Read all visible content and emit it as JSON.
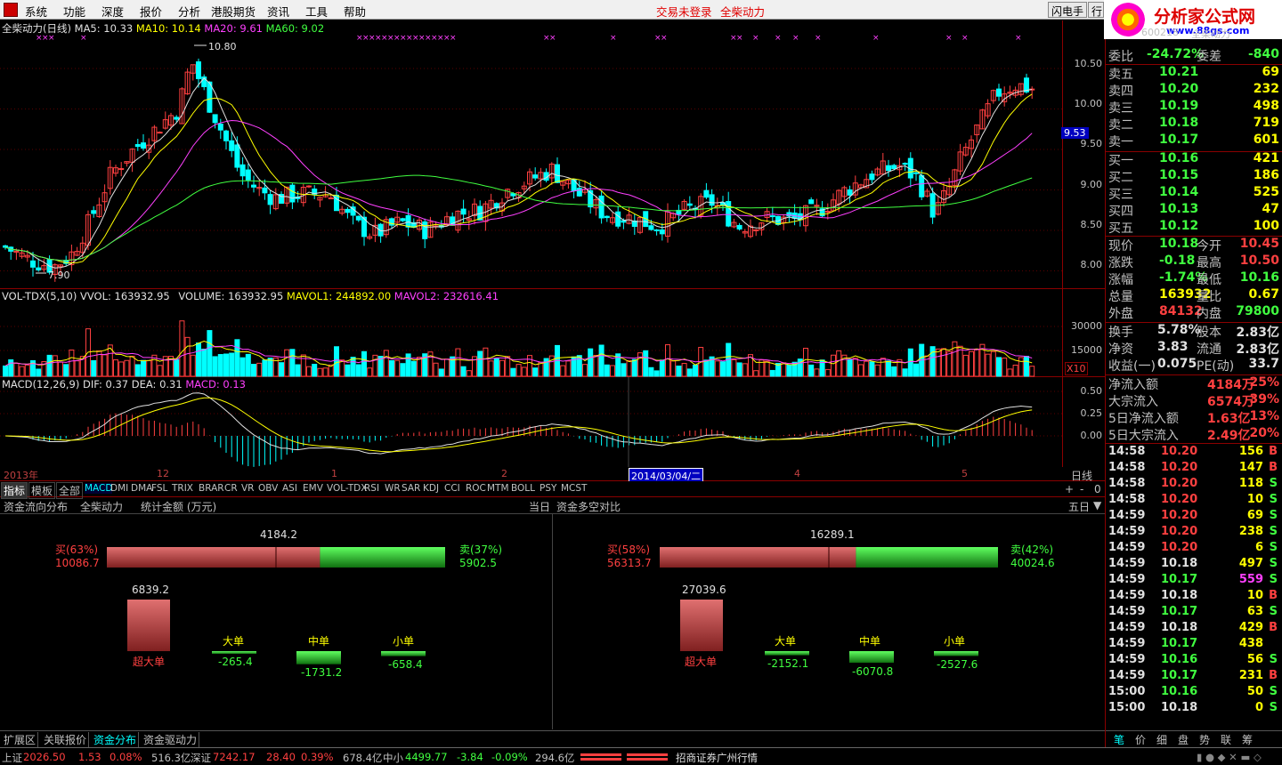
{
  "menu": {
    "items": [
      "系统",
      "功能",
      "深度",
      "报价",
      "分析",
      "港股期货",
      "资讯",
      "工具",
      "帮助"
    ],
    "trade_status": "交易未登录",
    "stock_name": "全柴动力",
    "flash_btn": "闪电手",
    "row_btn": "行"
  },
  "brand": {
    "name": "分析家公式网",
    "url": "www.88gs.com"
  },
  "kline": {
    "title": "全柴动力(日线)",
    "ma5": "MA5: 10.33",
    "ma10": "MA10: 10.14",
    "ma20": "MA20: 9.61",
    "ma60": "MA60: 9.02",
    "high_label": "10.80",
    "low_label": "7.90",
    "cur_price_tag": "9.53",
    "axis": [
      "10.50",
      "10.00",
      "9.50",
      "9.00",
      "8.50",
      "8.00"
    ]
  },
  "volume": {
    "title": "VOL-TDX(5,10)",
    "vvol": "VVOL: 163932.95",
    "volume": "VOLUME: 163932.95",
    "mavol1": "MAVOL1: 244892.00",
    "mavol2": "MAVOL2: 232616.41",
    "axis": [
      "30000",
      "15000"
    ],
    "unit": "X10"
  },
  "macd": {
    "title": "MACD(12,26,9)",
    "dif": "DIF: 0.37",
    "dea": "DEA: 0.31",
    "macd": "MACD: 0.13",
    "axis": [
      "0.50",
      "0.25",
      "0.00"
    ]
  },
  "dates": {
    "year": "2013年",
    "m12": "12",
    "m1": "1",
    "m2": "2",
    "cursor": "2014/03/04/二",
    "m4": "4",
    "m5": "5",
    "period": "日线"
  },
  "indicators": {
    "tabs": [
      "指标",
      "模板",
      "全部"
    ],
    "list": [
      "MACD",
      "DMI",
      "DMA",
      "FSL",
      "TRIX",
      "BRAR",
      "CR",
      "VR",
      "OBV",
      "ASI",
      "EMV",
      "VOL-TDX",
      "RSI",
      "WR",
      "SAR",
      "KDJ",
      "CCI",
      "ROC",
      "MTM",
      "BOLL",
      "PSY",
      "MCST"
    ],
    "controls": [
      "+",
      "-",
      "0"
    ]
  },
  "fund_header": {
    "title": "资金流向分布",
    "stock": "全柴动力",
    "unit": "统计金额 (万元)",
    "today": "当日",
    "compare": "资金多空对比",
    "period": "五日"
  },
  "fund_today": {
    "net": "4184.2",
    "buy_pct": "买(63%)",
    "buy_val": "10086.7",
    "sell_pct": "卖(37%)",
    "sell_val": "5902.5",
    "buy_ratio": 0.63,
    "bars": [
      {
        "label": "超大单",
        "value": "6839.2"
      },
      {
        "label": "大单",
        "value": "-265.4"
      },
      {
        "label": "中单",
        "value": "-1731.2"
      },
      {
        "label": "小单",
        "value": "-658.4"
      }
    ]
  },
  "fund_5day": {
    "net": "16289.1",
    "buy_pct": "买(58%)",
    "buy_val": "56313.7",
    "sell_pct": "卖(42%)",
    "sell_val": "40024.6",
    "buy_ratio": 0.58,
    "bars": [
      {
        "label": "超大单",
        "value": "27039.6"
      },
      {
        "label": "大单",
        "value": "-2152.1"
      },
      {
        "label": "中单",
        "value": "-6070.8"
      },
      {
        "label": "小单",
        "value": "-2527.6"
      }
    ]
  },
  "bottom_tabs": [
    "扩展区",
    "关联报价",
    "资金分布",
    "资金驱动力"
  ],
  "quote": {
    "code": "600218",
    "name": "全柴动力",
    "weibi": {
      "label": "委比",
      "value": "-24.72%",
      "label2": "委差",
      "value2": "-840"
    },
    "sells": [
      {
        "l": "卖五",
        "p": "10.21",
        "v": "69"
      },
      {
        "l": "卖四",
        "p": "10.20",
        "v": "232"
      },
      {
        "l": "卖三",
        "p": "10.19",
        "v": "498"
      },
      {
        "l": "卖二",
        "p": "10.18",
        "v": "719"
      },
      {
        "l": "卖一",
        "p": "10.17",
        "v": "601"
      }
    ],
    "buys": [
      {
        "l": "买一",
        "p": "10.16",
        "v": "421"
      },
      {
        "l": "买二",
        "p": "10.15",
        "v": "186"
      },
      {
        "l": "买三",
        "p": "10.14",
        "v": "525"
      },
      {
        "l": "买四",
        "p": "10.13",
        "v": "47"
      },
      {
        "l": "买五",
        "p": "10.12",
        "v": "100"
      }
    ],
    "stats": [
      {
        "a": "现价",
        "b": "10.18",
        "bc": "#40ff40",
        "c": "今开",
        "d": "10.45",
        "dc": "#ff4040"
      },
      {
        "a": "涨跌",
        "b": "-0.18",
        "bc": "#40ff40",
        "c": "最高",
        "d": "10.50",
        "dc": "#ff4040"
      },
      {
        "a": "涨幅",
        "b": "-1.74%",
        "bc": "#40ff40",
        "c": "最低",
        "d": "10.16",
        "dc": "#40ff40"
      },
      {
        "a": "总量",
        "b": "163932",
        "bc": "#ffff00",
        "c": "量比",
        "d": "0.67",
        "dc": "#ffff00"
      },
      {
        "a": "外盘",
        "b": "84132",
        "bc": "#ff4040",
        "c": "内盘",
        "d": "79800",
        "dc": "#40ff40"
      }
    ],
    "stats2": [
      {
        "a": "换手",
        "b": "5.78%",
        "c": "股本",
        "d": "2.83亿"
      },
      {
        "a": "净资",
        "b": "3.83",
        "c": "流通",
        "d": "2.83亿"
      },
      {
        "a": "收益(一)",
        "b": "0.075",
        "c": "PE(动)",
        "d": "33.7"
      }
    ],
    "flows": [
      {
        "a": "净流入额",
        "b": "4184万",
        "c": "25%"
      },
      {
        "a": "大宗流入",
        "b": "6574万",
        "c": "39%"
      },
      {
        "a": "5日净流入额",
        "b": "1.63亿",
        "c": "13%"
      },
      {
        "a": "5日大宗流入",
        "b": "2.49亿",
        "c": "20%"
      }
    ],
    "ticks": [
      {
        "t": "14:58",
        "p": "10.20",
        "v": "156",
        "s": "B"
      },
      {
        "t": "14:58",
        "p": "10.20",
        "v": "147",
        "s": "B"
      },
      {
        "t": "14:58",
        "p": "10.20",
        "v": "118",
        "s": "S"
      },
      {
        "t": "14:58",
        "p": "10.20",
        "v": "10",
        "s": "S"
      },
      {
        "t": "14:59",
        "p": "10.20",
        "v": "69",
        "s": "S"
      },
      {
        "t": "14:59",
        "p": "10.20",
        "v": "238",
        "s": "S"
      },
      {
        "t": "14:59",
        "p": "10.20",
        "v": "6",
        "s": "S"
      },
      {
        "t": "14:59",
        "p": "10.18",
        "v": "497",
        "s": "S"
      },
      {
        "t": "14:59",
        "p": "10.17",
        "v": "559",
        "s": "S"
      },
      {
        "t": "14:59",
        "p": "10.18",
        "v": "10",
        "s": "B"
      },
      {
        "t": "14:59",
        "p": "10.17",
        "v": "63",
        "s": "S"
      },
      {
        "t": "14:59",
        "p": "10.18",
        "v": "429",
        "s": "B"
      },
      {
        "t": "14:59",
        "p": "10.17",
        "v": "438",
        "s": ""
      },
      {
        "t": "14:59",
        "p": "10.16",
        "v": "56",
        "s": "S"
      },
      {
        "t": "14:59",
        "p": "10.17",
        "v": "231",
        "s": "B"
      },
      {
        "t": "15:00",
        "p": "10.16",
        "v": "50",
        "s": "S"
      },
      {
        "t": "15:00",
        "p": "10.18",
        "v": "0",
        "s": "S"
      }
    ],
    "tabs": [
      "笔",
      "价",
      "细",
      "盘",
      "势",
      "联",
      "筹"
    ]
  },
  "status": {
    "sh_label": "上证",
    "sh": "2026.50",
    "sh_chg": "1.53",
    "sh_pct": "0.08%",
    "sh_amt": "516.3亿",
    "sz_label": "深证",
    "sz": "7242.17",
    "sz_chg": "28.40",
    "sz_pct": "0.39%",
    "sz_amt": "678.4亿",
    "zx_label": "中小",
    "zx": "4499.77",
    "zx_chg": "-3.84",
    "zx_pct": "-0.09%",
    "zx_amt": "294.6亿",
    "broker": "招商证券广州行情"
  },
  "colors": {
    "up": "#ff4040",
    "down": "#00ffff",
    "ma5": "#e0e0e0",
    "ma10": "#ffff00",
    "ma20": "#ff40ff",
    "ma60": "#40ff40"
  }
}
